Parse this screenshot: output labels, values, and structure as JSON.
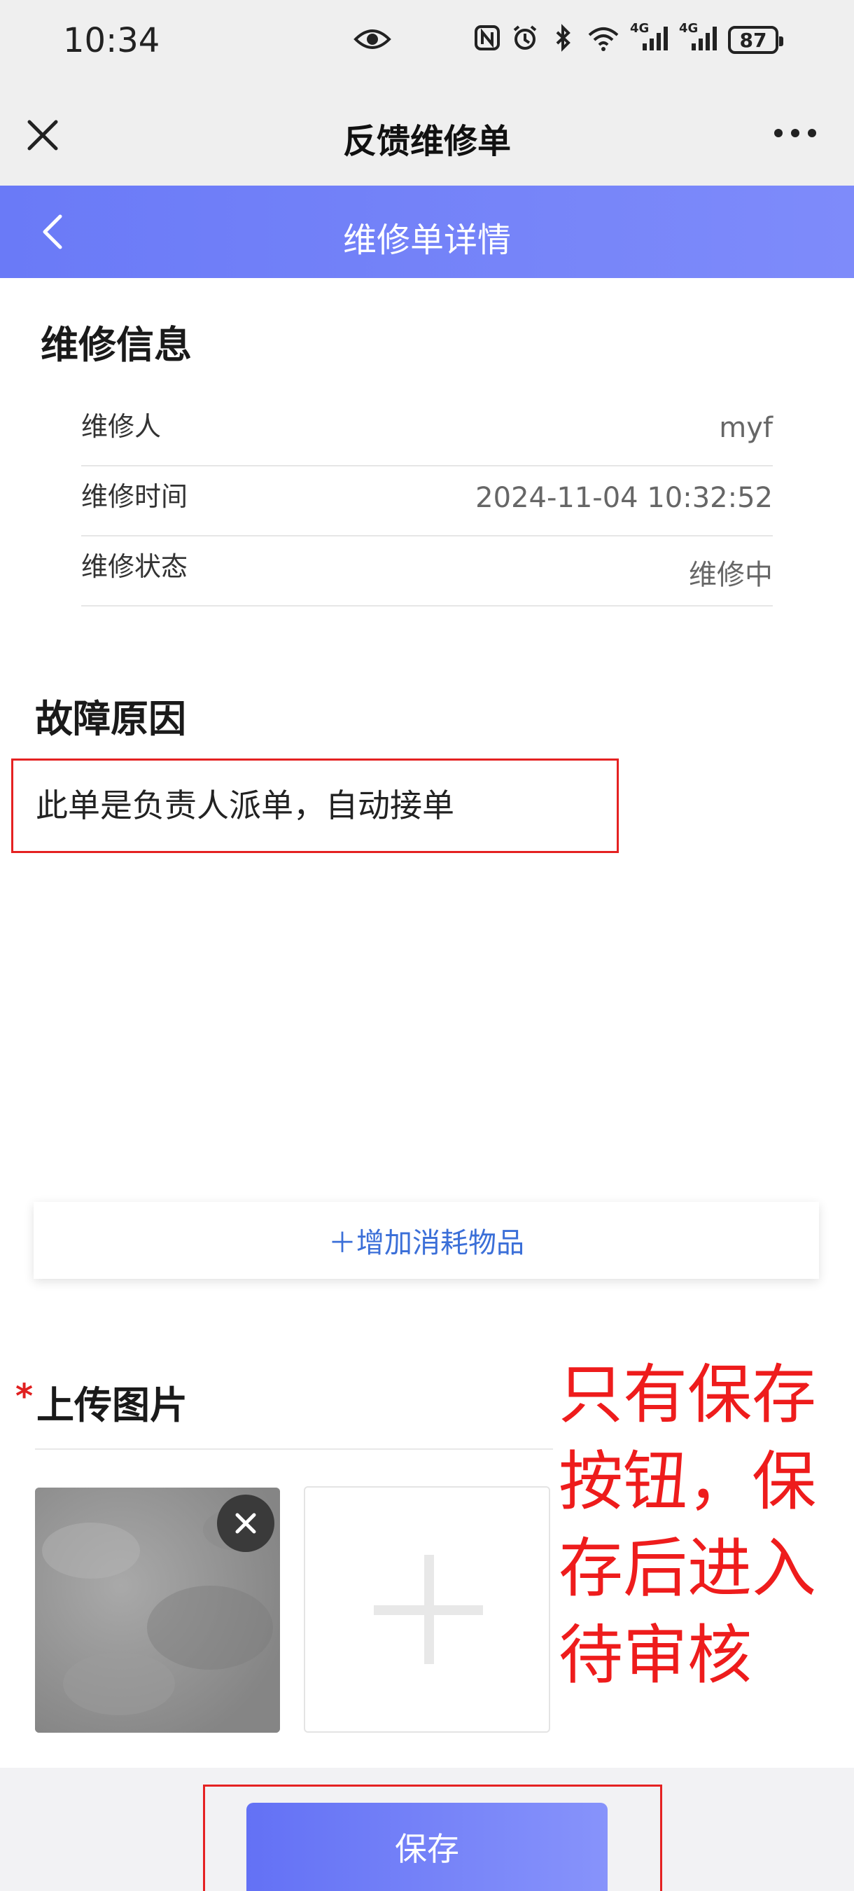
{
  "status_bar": {
    "time": "10:34",
    "network_1": "4G",
    "network_2": "4G",
    "battery": "87"
  },
  "wechat_bar": {
    "title": "反馈维修单"
  },
  "header": {
    "title": "维修单详情"
  },
  "repair_info": {
    "title": "维修信息",
    "rows": [
      {
        "label": "维修人",
        "value": "myf"
      },
      {
        "label": "维修时间",
        "value": "2024-11-04 10:32:52"
      },
      {
        "label": "维修状态",
        "value": "维修中"
      }
    ]
  },
  "fault": {
    "title": "故障原因",
    "text": "此单是负责人派单，自动接单"
  },
  "consumables": {
    "add_label": "＋增加消耗物品"
  },
  "upload": {
    "required_mark": "*",
    "title": "上传图片"
  },
  "annotation": {
    "line1": "只有保存",
    "line2": "按钮，保",
    "line3": "存后进入",
    "line4": "待审核"
  },
  "footer": {
    "save_label": "保存"
  },
  "colors": {
    "header": "#6f7ff8",
    "annotation": "#ee1c1c",
    "link": "#3b6fd8"
  }
}
